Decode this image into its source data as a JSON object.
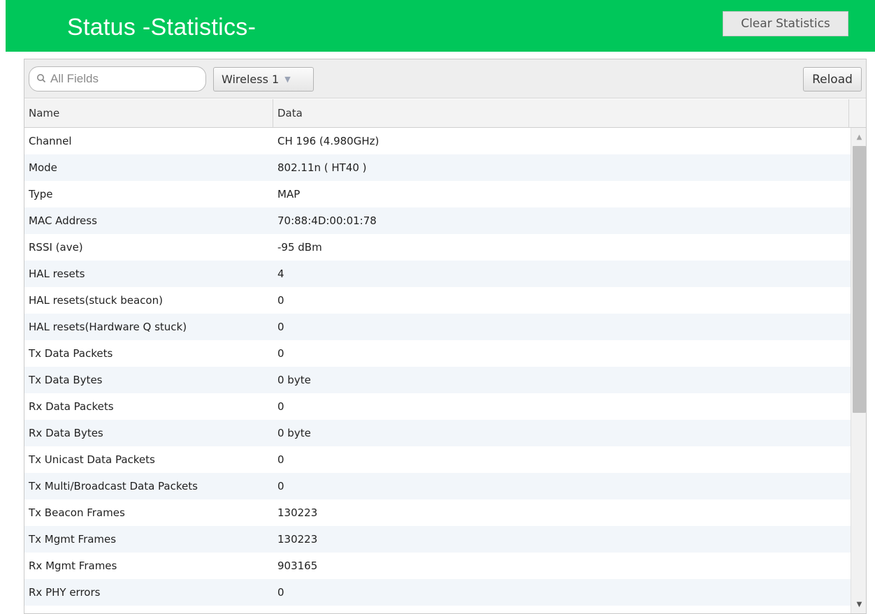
{
  "header": {
    "title": "Status -Statistics-",
    "clear_label": "Clear Statistics",
    "accent_color": "#00c75a"
  },
  "toolbar": {
    "search_placeholder": "All Fields",
    "search_icon": "search-icon",
    "select_value": "Wireless 1",
    "reload_label": "Reload"
  },
  "table": {
    "columns": [
      "Name",
      "Data"
    ],
    "rows": [
      {
        "name": "Channel",
        "data": "CH 196 (4.980GHz)"
      },
      {
        "name": "Mode",
        "data": "802.11n ( HT40 )"
      },
      {
        "name": "Type",
        "data": "MAP"
      },
      {
        "name": "MAC Address",
        "data": "70:88:4D:00:01:78"
      },
      {
        "name": "RSSI (ave)",
        "data": "-95 dBm"
      },
      {
        "name": "HAL resets",
        "data": "4"
      },
      {
        "name": "HAL resets(stuck beacon)",
        "data": "0"
      },
      {
        "name": "HAL resets(Hardware Q stuck)",
        "data": "0"
      },
      {
        "name": "Tx Data Packets",
        "data": "0"
      },
      {
        "name": "Tx Data Bytes",
        "data": "0 byte"
      },
      {
        "name": "Rx Data Packets",
        "data": "0"
      },
      {
        "name": "Rx Data Bytes",
        "data": "0 byte"
      },
      {
        "name": "Tx Unicast Data Packets",
        "data": "0"
      },
      {
        "name": "Tx Multi/Broadcast Data Packets",
        "data": "0"
      },
      {
        "name": "Tx Beacon Frames",
        "data": "130223"
      },
      {
        "name": "Tx Mgmt Frames",
        "data": "130223"
      },
      {
        "name": "Rx Mgmt Frames",
        "data": "903165"
      },
      {
        "name": "Rx PHY errors",
        "data": "0"
      }
    ]
  }
}
